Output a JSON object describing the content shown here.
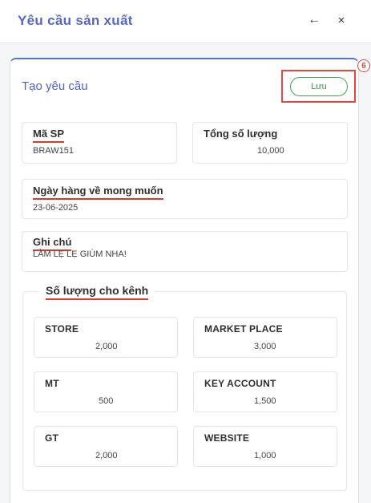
{
  "header": {
    "title": "Yêu cầu sản xuất",
    "back_glyph": "←",
    "close_glyph": "×"
  },
  "panel": {
    "title": "Tạo yêu cầu",
    "save_label": "Lưu",
    "step_badge": "6"
  },
  "fields": {
    "product_code": {
      "label": "Mã SP",
      "value": "BRAW151"
    },
    "total_qty": {
      "label": "Tổng số lượng",
      "value": "10,000"
    },
    "desired_date": {
      "label": "Ngày hàng về mong muốn",
      "value": "23-06-2025"
    },
    "note": {
      "label": "Ghi chú",
      "value": "LÀM LẸ LẸ GIÙM NHA!"
    }
  },
  "channels": {
    "section_title": "Số lượng cho kênh",
    "items": [
      {
        "label": "STORE",
        "value": "2,000"
      },
      {
        "label": "MARKET PLACE",
        "value": "3,000"
      },
      {
        "label": "MT",
        "value": "500"
      },
      {
        "label": "KEY ACCOUNT",
        "value": "1,500"
      },
      {
        "label": "GT",
        "value": "2,000"
      },
      {
        "label": "WEBSITE",
        "value": "1,000"
      }
    ]
  },
  "colors": {
    "accent": "#5567c8",
    "save_green": "#2e9a4f",
    "highlight_red": "#e2483d"
  }
}
